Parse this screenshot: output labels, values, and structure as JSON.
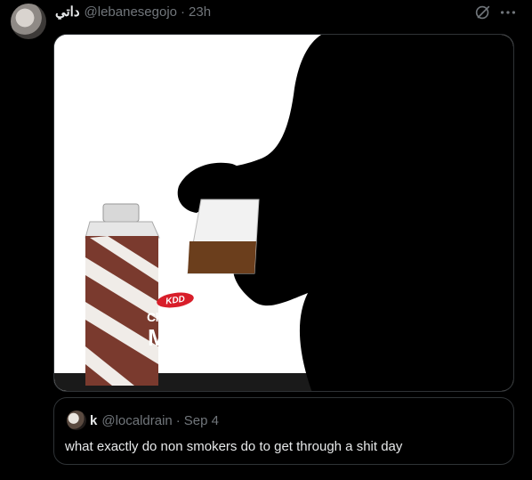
{
  "post": {
    "display_name": "داتي",
    "handle": "@lebanesegojo",
    "separator": "·",
    "time": "23h"
  },
  "media": {
    "carton_brand": "KDD",
    "carton_line1": "Chocolate",
    "carton_line2": "Milk"
  },
  "quote": {
    "display_name": "k",
    "handle": "@localdrain",
    "separator": "·",
    "date": "Sep 4",
    "text": "what exactly do non smokers do to get through a shit day"
  },
  "icons": {
    "grok": "grok-icon",
    "more": "more-icon"
  },
  "colors": {
    "background": "#000000",
    "text_primary": "#e7e9ea",
    "text_secondary": "#71767b",
    "border": "#2f3336"
  }
}
